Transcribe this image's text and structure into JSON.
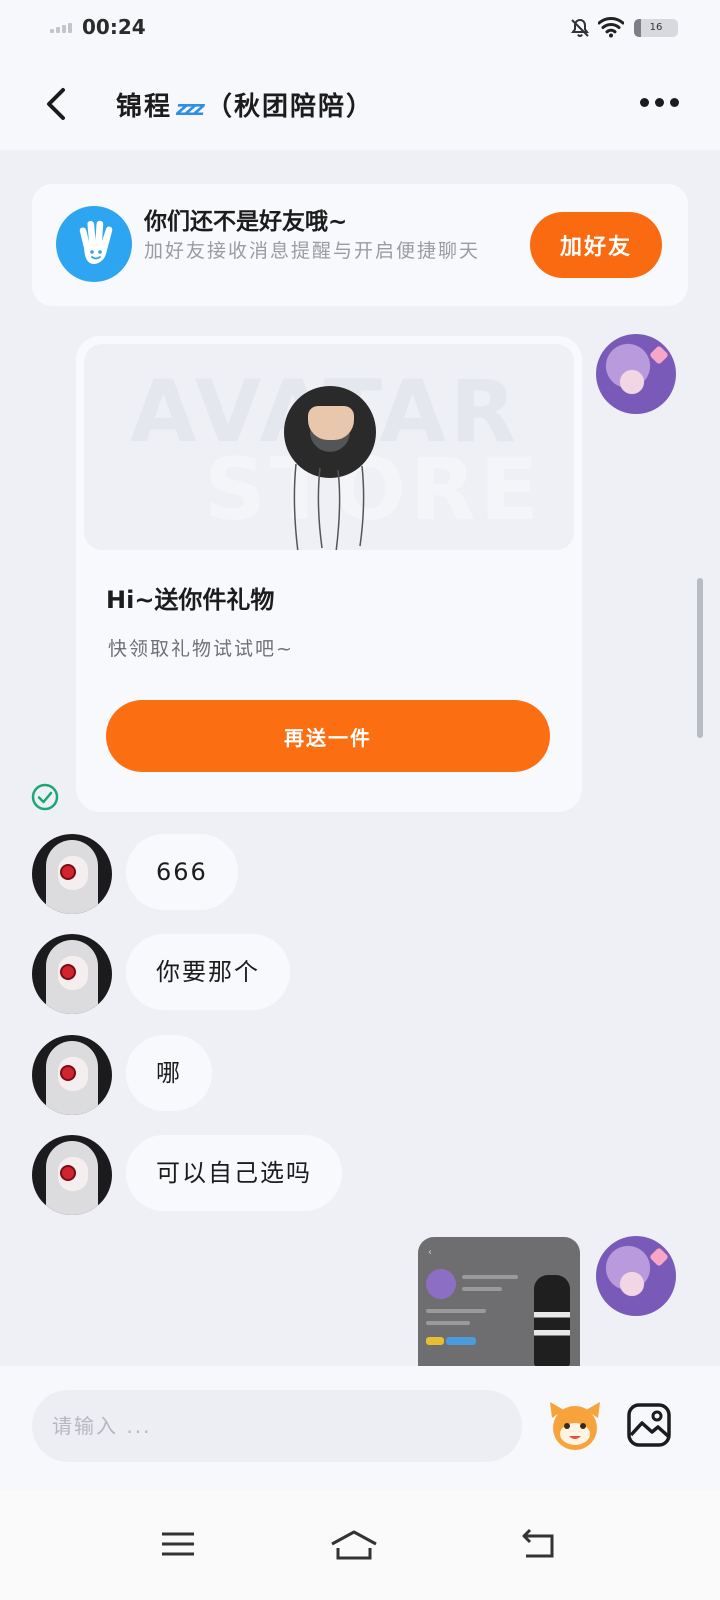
{
  "status_bar": {
    "time": "00:24",
    "battery": "16",
    "battery_level": 0.16
  },
  "header": {
    "title_name": "锦程",
    "title_suffix": "（秋团陪陪）"
  },
  "friend_banner": {
    "title": "你们还不是好友哦~",
    "subtitle": "加好友接收消息提醒与开启便捷聊天",
    "button_label": "加好友"
  },
  "gift_card": {
    "watermark_line1": "AVATAR",
    "watermark_line2": "STORE",
    "title": "Hi~送你件礼物",
    "subtitle": "快领取礼物试试吧~",
    "button_label": "再送一件"
  },
  "messages": [
    {
      "text": "666"
    },
    {
      "text": "你要那个"
    },
    {
      "text": "哪"
    },
    {
      "text": "可以自己选吗"
    }
  ],
  "input": {
    "placeholder": "请输入 ..."
  },
  "colors": {
    "accent": "#fa6a10",
    "banner_icon": "#2ea5f0",
    "read_check": "#18a874"
  },
  "icons": [
    "back-icon",
    "more-icon",
    "wave-hand-icon",
    "read-check-icon",
    "emoji-icon",
    "image-icon",
    "menu-icon",
    "home-icon",
    "back-nav-icon"
  ]
}
